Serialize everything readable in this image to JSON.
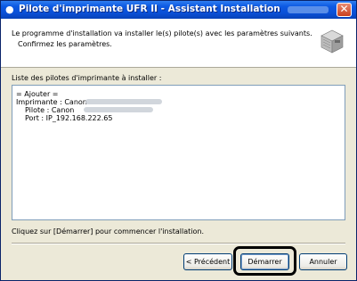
{
  "window": {
    "title": "Pilote d'imprimante UFR II - Assistant Installation"
  },
  "header": {
    "line1": "Le programme d'installation va installer le(s) pilote(s) avec les paramètres suivants.",
    "line2": "Confirmez les paramètres."
  },
  "list": {
    "label": "Liste des pilotes d'imprimante à installer :",
    "rows": [
      "= Ajouter =",
      "Imprimante : Canon",
      "Pilote       : Canon",
      "Port          : IP_192.168.222.65"
    ]
  },
  "footer": {
    "instruction": "Cliquez sur [Démarrer] pour commencer l'installation."
  },
  "buttons": {
    "previous": "< Précédent",
    "start": "Démarrer",
    "cancel": "Annuler"
  },
  "colors": {
    "titlebar": "#0a4fd6",
    "highlight_ring": "#000000"
  }
}
